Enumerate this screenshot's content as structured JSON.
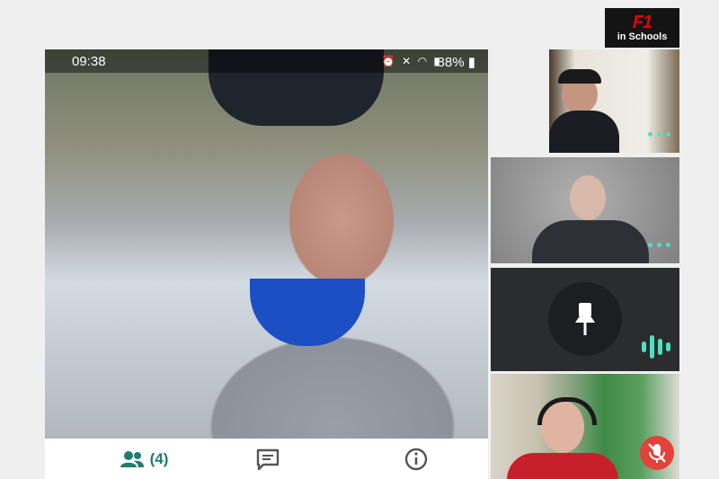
{
  "branding": {
    "logo_text": "F1",
    "logo_sub": "in Schools"
  },
  "status_bar": {
    "time": "09:38",
    "battery": "88%"
  },
  "bottom_bar": {
    "participants_count": "(4)"
  },
  "colors": {
    "accent": "#1e7e6d",
    "indicator": "#4fe0c0",
    "muted_red": "#e3413a",
    "brand_red": "#e10600"
  },
  "icons": [
    "alarm-icon",
    "vibrate-icon",
    "wifi-icon",
    "signal-icon",
    "battery-icon",
    "people-icon",
    "chat-icon",
    "info-icon",
    "more-dots-icon",
    "pin-icon",
    "audio-level-icon",
    "mic-off-icon"
  ]
}
